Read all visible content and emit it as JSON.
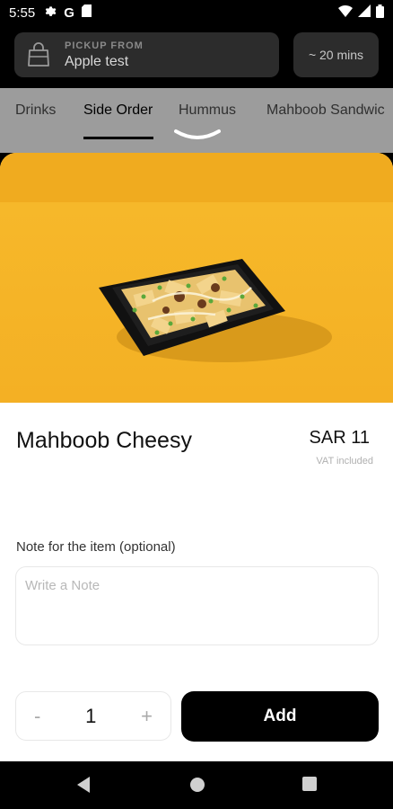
{
  "status_bar": {
    "time": "5:55",
    "left_icons": [
      "gear-icon",
      "google-icon",
      "sd-card-icon"
    ],
    "right_icons": [
      "wifi-icon",
      "signal-icon",
      "battery-icon"
    ],
    "google_letter": "G"
  },
  "header": {
    "pickup_label": "PICKUP FROM",
    "pickup_value": "Apple test",
    "time_estimate": "~ 20 mins"
  },
  "tabs": [
    {
      "label": "Drinks",
      "active": false
    },
    {
      "label": "Side Order",
      "active": true
    },
    {
      "label": "Hummus",
      "active": false
    },
    {
      "label": "Mahboob Sandwic",
      "active": false
    }
  ],
  "item": {
    "name": "Mahboob Cheesy",
    "price": "SAR 11",
    "vat_note": "VAT included"
  },
  "note": {
    "label": "Note for the item (optional)",
    "placeholder": "Write a Note",
    "value": ""
  },
  "order": {
    "minus": "-",
    "quantity": "1",
    "plus": "+",
    "add_label": "Add"
  },
  "colors": {
    "hero_yellow": "#f4b024",
    "primary": "#000000",
    "tab_bg": "#9c9c9c"
  }
}
